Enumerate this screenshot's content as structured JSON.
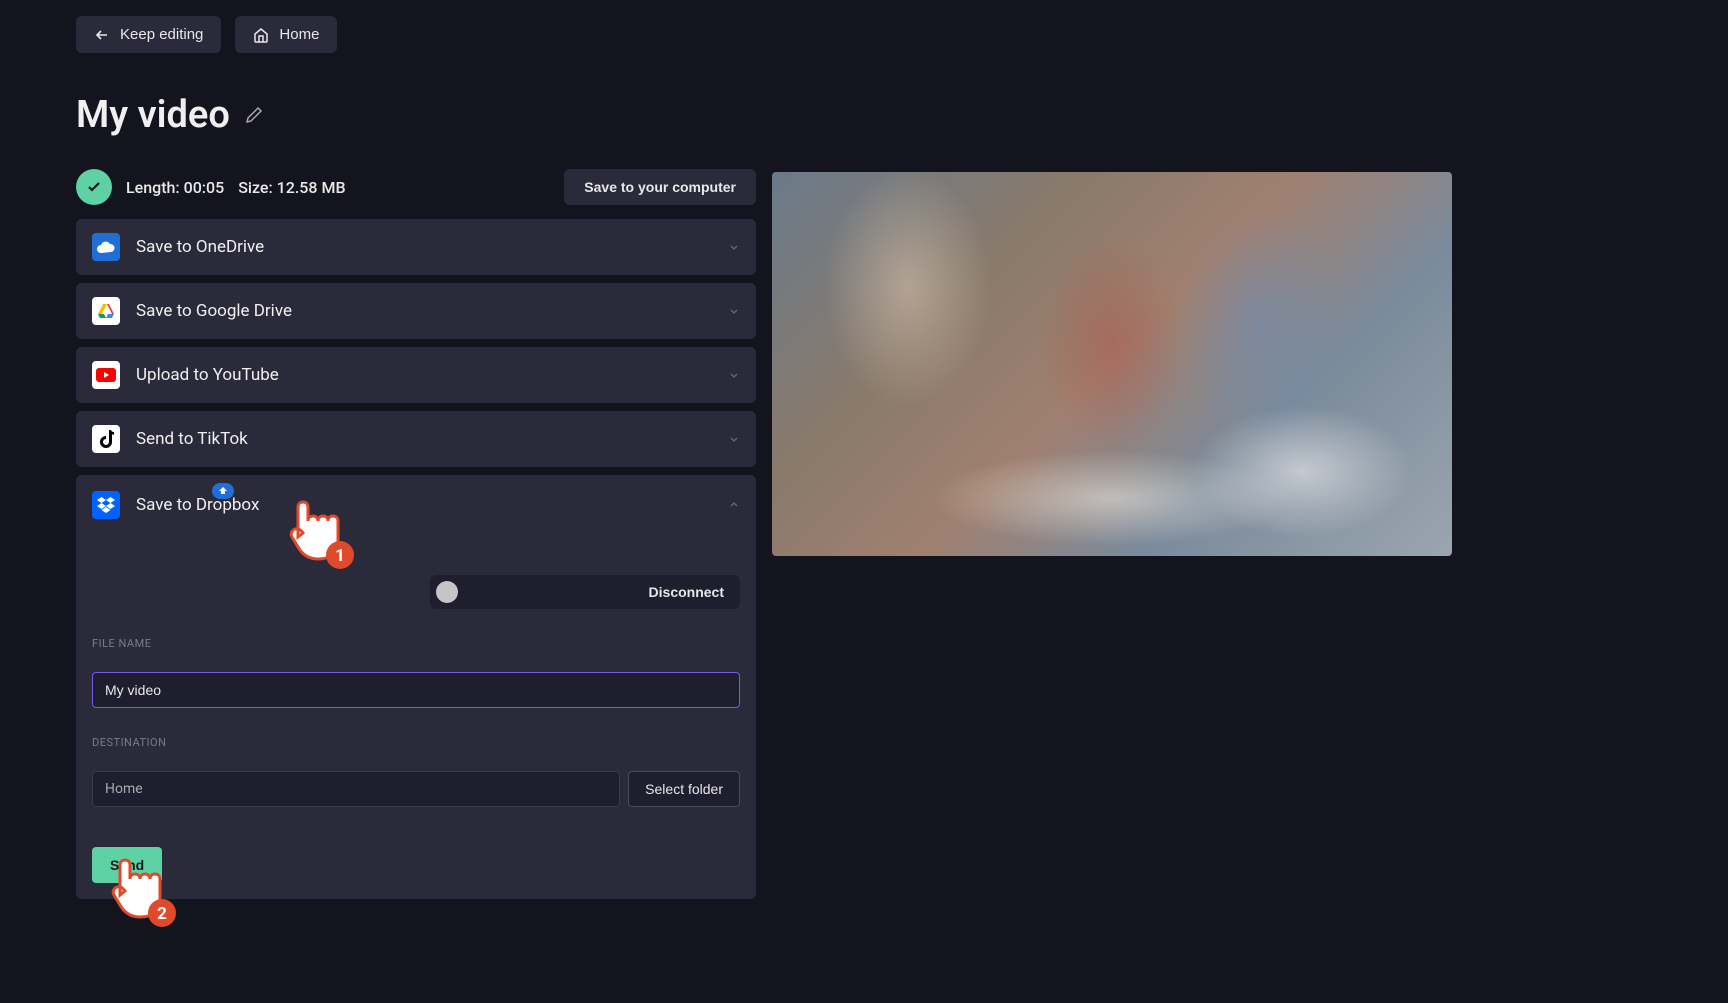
{
  "header": {
    "keep_editing": "Keep editing",
    "home": "Home"
  },
  "title": "My video",
  "info": {
    "length_label": "Length:",
    "length_value": "00:05",
    "size_label": "Size:",
    "size_value": "12.58 MB",
    "save_computer": "Save to your computer"
  },
  "options": {
    "onedrive": "Save to OneDrive",
    "gdrive": "Save to Google Drive",
    "youtube": "Upload to YouTube",
    "tiktok": "Send to TikTok",
    "dropbox": "Save to Dropbox"
  },
  "dropbox_panel": {
    "disconnect": "Disconnect",
    "filename_label": "FILE NAME",
    "filename_value": "My video",
    "destination_label": "DESTINATION",
    "destination_value": "Home",
    "select_folder": "Select folder",
    "send": "Send"
  },
  "annotations": {
    "step1": "1",
    "step2": "2"
  }
}
